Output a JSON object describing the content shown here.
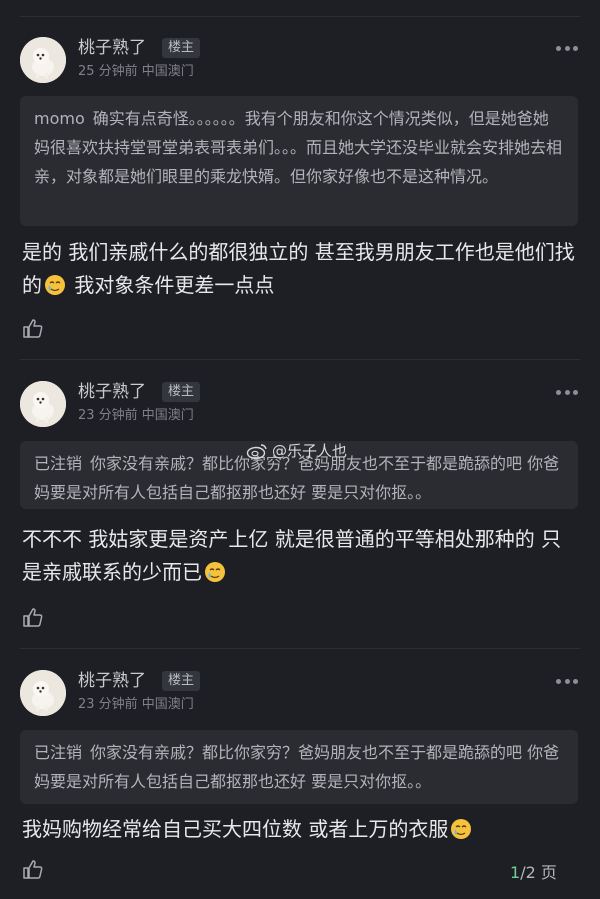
{
  "watermark": {
    "icon": "weibo-icon",
    "text": "@乐子人也"
  },
  "pager": {
    "current": "1",
    "total_text": "/2 页"
  },
  "posts": [
    {
      "username": "桃子熟了",
      "badge": "楼主",
      "meta": "25 分钟前  中国澳门",
      "quote_name": "momo",
      "quote_text": "确实有点奇怪。。。。。。我有个朋友和你这个情况类似，但是她爸她妈很喜欢扶持堂哥堂弟表哥表弟们。。。而且她大学还没毕业就会安排她去相亲，对象都是她们眼里的乘龙快婿。但你家好像也不是这种情况。",
      "content_a": "是的 我们亲戚什么的都很独立的 甚至我男朋友工作也是他们找的",
      "content_b": " 我对象条件更差一点点"
    },
    {
      "username": "桃子熟了",
      "badge": "楼主",
      "meta": "23 分钟前  中国澳门",
      "quote_name": "已注销",
      "quote_text": "你家没有亲戚？都比你家穷？爸妈朋友也不至于都是跪舔的吧 你爸妈要是对所有人包括自己都抠那也还好  要是只对你抠。。",
      "content_a": "不不不 我姑家更是资产上亿 就是很普通的平等相处那种的 只是亲戚联系的少而已",
      "content_b": ""
    },
    {
      "username": "桃子熟了",
      "badge": "楼主",
      "meta": "23 分钟前  中国澳门",
      "quote_name": "已注销",
      "quote_text": "你家没有亲戚？都比你家穷？爸妈朋友也不至于都是跪舔的吧 你爸妈要是对所有人包括自己都抠那也还好  要是只对你抠。。",
      "content_a": "我妈购物经常给自己买大四位数 或者上万的衣服",
      "content_b": ""
    }
  ]
}
